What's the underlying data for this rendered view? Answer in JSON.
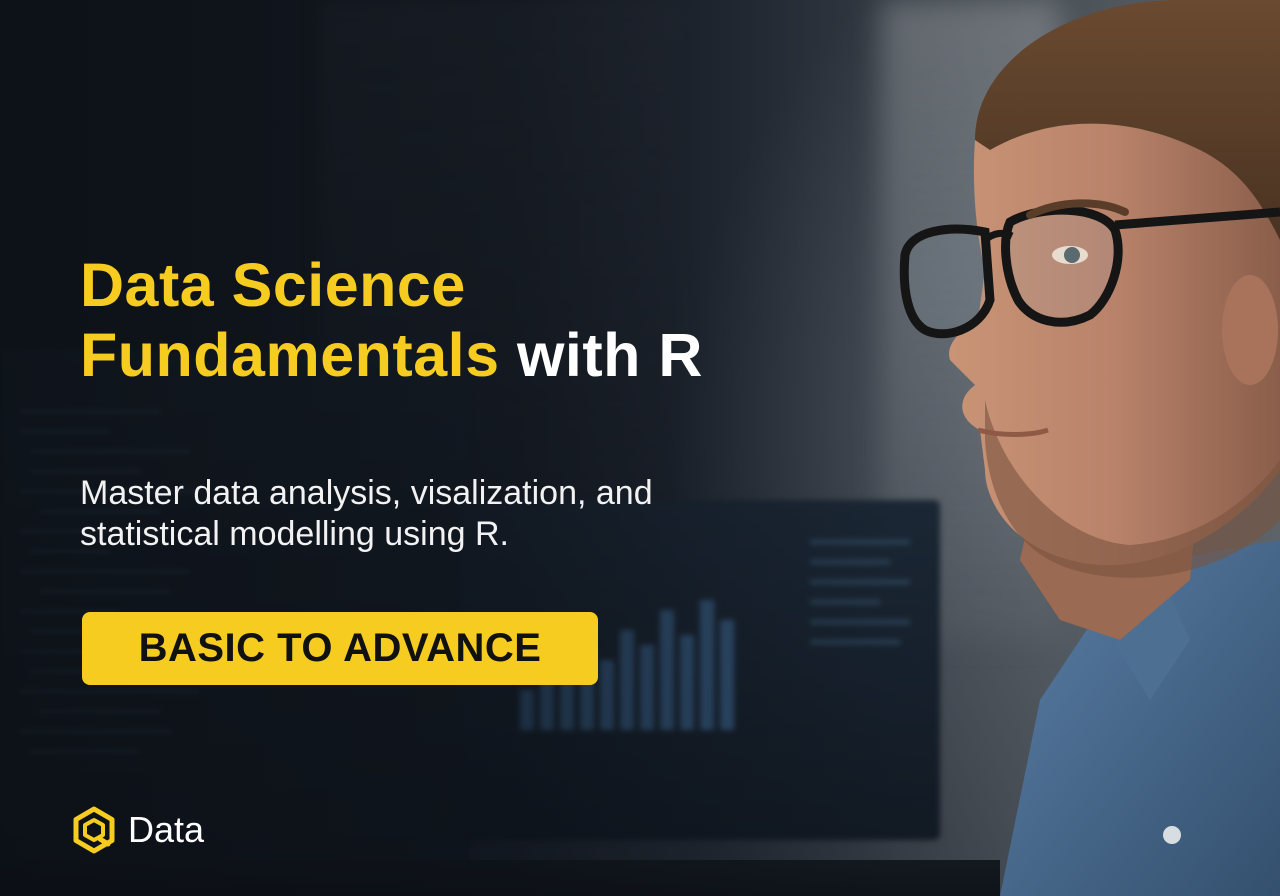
{
  "headline": {
    "line1_yellow": "Data Science",
    "line2_yellow": "Fundamentals",
    "line2_white": "with R"
  },
  "subtitle": {
    "line1": "Master data analysis, visalization, and",
    "line2": "statistical modelling using R."
  },
  "badge": {
    "label": "BASIC TO ADVANCE"
  },
  "brand": {
    "name": "Data",
    "logo_icon": "hexagon-logo-icon"
  },
  "colors": {
    "accent": "#f5cc1f",
    "text": "#ffffff",
    "background": "#141a22"
  }
}
